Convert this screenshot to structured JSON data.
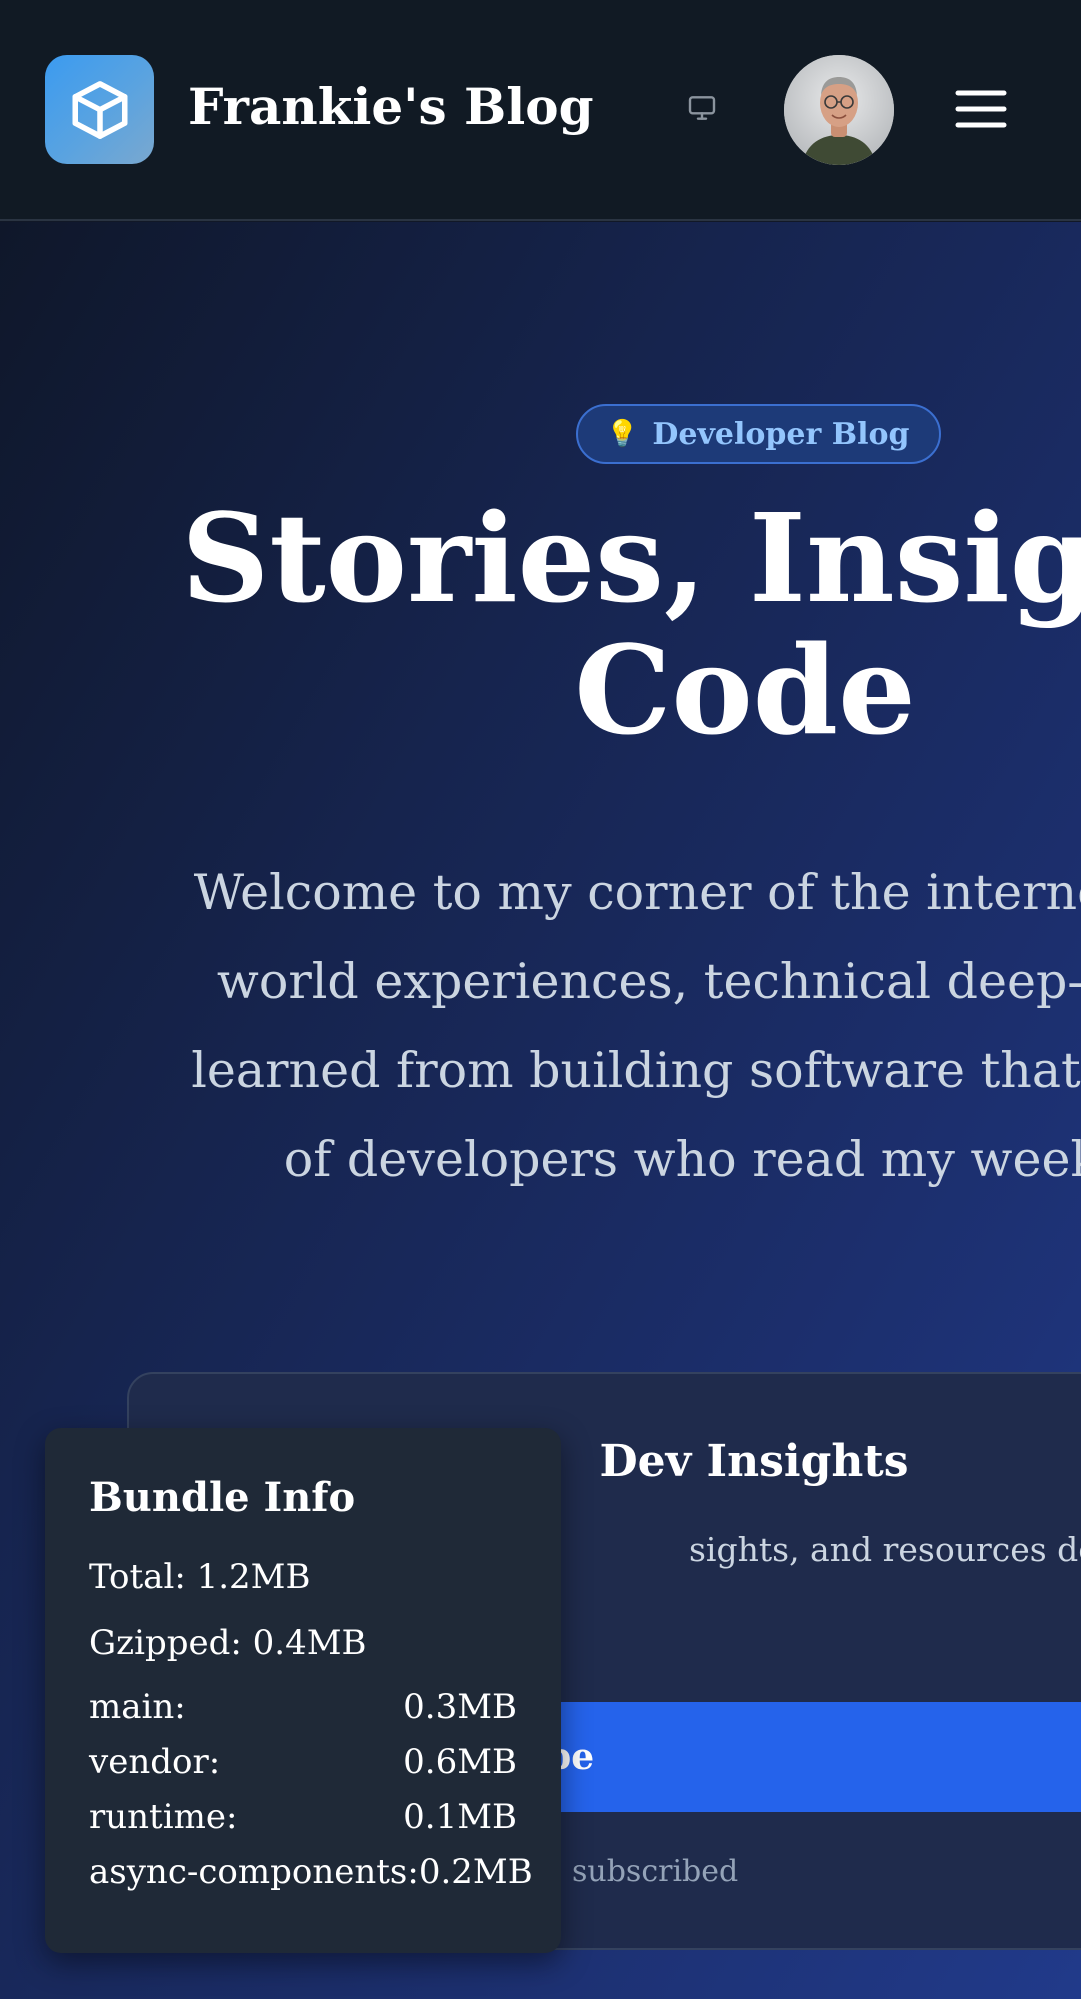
{
  "header": {
    "site_title": "Frankie's Blog",
    "logo_icon": "cube-icon",
    "device_icon": "monitor-icon",
    "avatar_alt": "Frankie avatar",
    "menu_icon": "hamburger-menu-icon"
  },
  "hero": {
    "badge_icon": "💡",
    "badge_label": "Developer Blog",
    "title_line1": "Stories, Insights",
    "title_line2": "Code",
    "description_lines": [
      "Welcome to my corner of the internet where",
      "world experiences, technical deep-dives, a",
      "learned from building software that scales. J",
      "of developers who read my weekly in"
    ]
  },
  "newsletter": {
    "title": "Dev Insights",
    "description": "sights, and resources delivered to",
    "subscribe_label": "Subscribe",
    "note": "subscribed"
  },
  "bundle_info": {
    "title": "Bundle Info",
    "total": "Total: 1.2MB",
    "gzipped": "Gzipped: 0.4MB",
    "chunks": [
      {
        "name": "main:",
        "size": "0.3MB"
      },
      {
        "name": "vendor:",
        "size": "0.6MB"
      },
      {
        "name": "runtime:",
        "size": "0.1MB"
      },
      {
        "name": "async-components:",
        "size": "0.2MB"
      }
    ]
  },
  "colors": {
    "header_bg": "#111a24",
    "accent_blue": "#2563eb",
    "badge_text": "#93c5fd",
    "hero_bg_start": "#0f172a",
    "hero_bg_end": "#213a8a"
  }
}
